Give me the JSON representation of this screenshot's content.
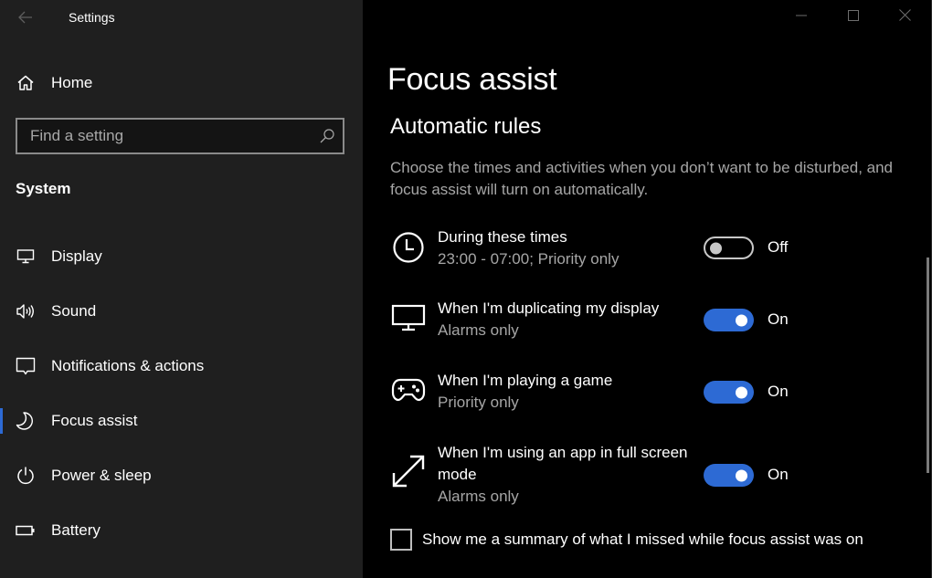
{
  "window": {
    "app_title": "Settings",
    "controls": {
      "minimize": "minimize-icon",
      "maximize": "maximize-icon",
      "close": "close-icon"
    }
  },
  "sidebar": {
    "home_label": "Home",
    "search": {
      "placeholder": "Find a setting",
      "value": ""
    },
    "section_title": "System",
    "items": [
      {
        "label": "Display",
        "icon": "monitor-icon",
        "active": false
      },
      {
        "label": "Sound",
        "icon": "speaker-icon",
        "active": false
      },
      {
        "label": "Notifications & actions",
        "icon": "notification-icon",
        "active": false
      },
      {
        "label": "Focus assist",
        "icon": "moon-icon",
        "active": true
      },
      {
        "label": "Power & sleep",
        "icon": "power-icon",
        "active": false
      },
      {
        "label": "Battery",
        "icon": "battery-icon",
        "active": false
      }
    ]
  },
  "main": {
    "page_title": "Focus assist",
    "section_title": "Automatic rules",
    "description": "Choose the times and activities when you don’t want to be disturbed, and focus assist will turn on automatically.",
    "rules": [
      {
        "title": "During these times",
        "subtitle": "23:00 - 07:00; Priority only",
        "icon": "clock-icon",
        "enabled": false,
        "state_label": "Off"
      },
      {
        "title": "When I'm duplicating my display",
        "subtitle": "Alarms only",
        "icon": "monitor-icon",
        "enabled": true,
        "state_label": "On"
      },
      {
        "title": "When I'm playing a game",
        "subtitle": "Priority only",
        "icon": "gamepad-icon",
        "enabled": true,
        "state_label": "On"
      },
      {
        "title": "When I'm using an app in full screen mode",
        "subtitle": "Alarms only",
        "icon": "fullscreen-icon",
        "enabled": true,
        "state_label": "On"
      }
    ],
    "summary_checkbox": {
      "label": "Show me a summary of what I missed while focus assist was on",
      "checked": false
    }
  },
  "colors": {
    "accent": "#2d6ad4",
    "sidebar_bg": "#1f1f1f",
    "content_bg": "#000000",
    "secondary_text": "#a6a6a6"
  }
}
